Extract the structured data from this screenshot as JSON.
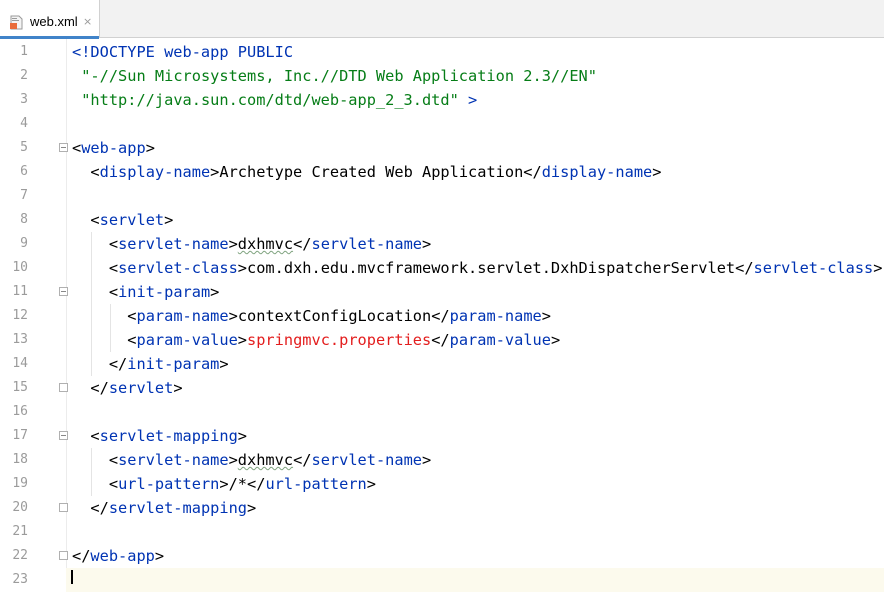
{
  "tab": {
    "filename": "web.xml",
    "close_glyph": "×",
    "icon": "xml-file-icon"
  },
  "line_numbers": [
    "1",
    "2",
    "3",
    "4",
    "5",
    "6",
    "7",
    "8",
    "9",
    "10",
    "11",
    "12",
    "13",
    "14",
    "15",
    "16",
    "17",
    "18",
    "19",
    "20",
    "21",
    "22",
    "23"
  ],
  "lines": {
    "l1_a": "<!DOCTYPE web-app PUBLIC",
    "l2_a": "\"-//Sun Microsystems, Inc.//DTD Web Application 2.3//EN\"",
    "l3_a": "\"http://java.sun.com/dtd/web-app_2_3.dtd\"",
    "l3_b": " >",
    "l5_open": "<",
    "l5_name": "web-app",
    "l5_close": ">",
    "l6_ot": "<",
    "l6_tn": "display-name",
    "l6_gt": ">",
    "l6_text": "Archetype Created Web Application",
    "l6_ct": "</",
    "l6_tn2": "display-name",
    "l6_gt2": ">",
    "l8_ot": "<",
    "l8_tn": "servlet",
    "l8_gt": ">",
    "l9_ot": "<",
    "l9_tn": "servlet-name",
    "l9_gt": ">",
    "l9_text": "dxhmvc",
    "l9_ct": "</",
    "l9_tn2": "servlet-name",
    "l9_gt2": ">",
    "l10_ot": "<",
    "l10_tn": "servlet-class",
    "l10_gt": ">",
    "l10_text": "com.dxh.edu.mvcframework.servlet.DxhDispatcherServlet",
    "l10_ct": "</",
    "l10_tn2": "servlet-class",
    "l10_gt2": ">",
    "l11_ot": "<",
    "l11_tn": "init-param",
    "l11_gt": ">",
    "l12_ot": "<",
    "l12_tn": "param-name",
    "l12_gt": ">",
    "l12_text": "contextConfigLocation",
    "l12_ct": "</",
    "l12_tn2": "param-name",
    "l12_gt2": ">",
    "l13_ot": "<",
    "l13_tn": "param-value",
    "l13_gt": ">",
    "l13_text": "springmvc.properties",
    "l13_ct": "</",
    "l13_tn2": "param-value",
    "l13_gt2": ">",
    "l14_ct": "</",
    "l14_tn": "init-param",
    "l14_gt": ">",
    "l15_ct": "</",
    "l15_tn": "servlet",
    "l15_gt": ">",
    "l17_ot": "<",
    "l17_tn": "servlet-mapping",
    "l17_gt": ">",
    "l18_ot": "<",
    "l18_tn": "servlet-name",
    "l18_gt": ">",
    "l18_text": "dxhmvc",
    "l18_ct": "</",
    "l18_tn2": "servlet-name",
    "l18_gt2": ">",
    "l19_ot": "<",
    "l19_tn": "url-pattern",
    "l19_gt": ">",
    "l19_text": "/*",
    "l19_ct": "</",
    "l19_tn2": "url-pattern",
    "l19_gt2": ">",
    "l20_ct": "</",
    "l20_tn": "servlet-mapping",
    "l20_gt": ">",
    "l22_ct": "</",
    "l22_tn": "web-app",
    "l22_gt": ">"
  },
  "colors": {
    "tag": "#0033b3",
    "string": "#067d17",
    "error": "#e31d1d",
    "line_number": "#9b9b9b",
    "tab_underline": "#4083c9"
  }
}
